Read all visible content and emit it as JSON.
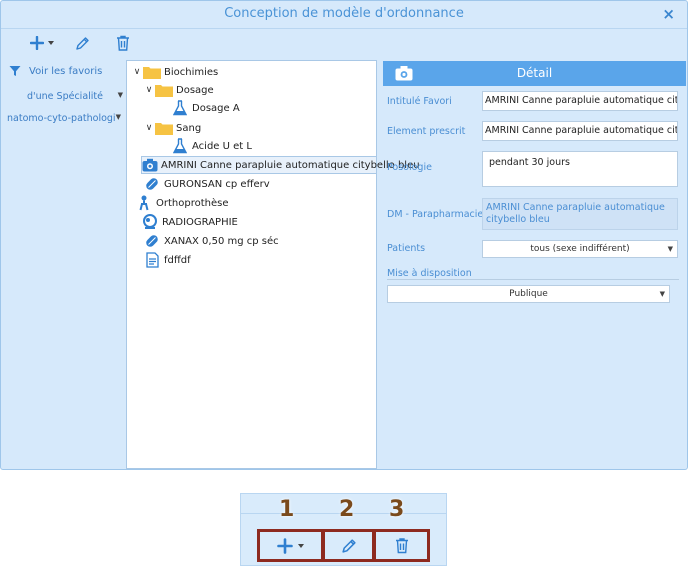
{
  "dialog": {
    "title": "Conception de modèle d'ordonnance",
    "close_glyph": "×"
  },
  "toolbar": {
    "add_icon": "plus-icon",
    "dropdown_icon": "caret-down-icon",
    "edit_icon": "pencil-icon",
    "delete_icon": "trash-icon"
  },
  "filters": {
    "favorites_label": "Voir les favoris",
    "specialty_label": "d'une Spécialité",
    "anatomy_label": "natomo-cyto-pathologi"
  },
  "tree": {
    "nodes": [
      {
        "label": "Biochimies",
        "icon": "folder-icon"
      },
      {
        "label": "Dosage",
        "icon": "folder-icon"
      },
      {
        "label": "Dosage A",
        "icon": "flask-icon"
      },
      {
        "label": "Sang",
        "icon": "folder-icon"
      },
      {
        "label": "Acide U et L",
        "icon": "flask-icon"
      },
      {
        "label": "AMRINI Canne parapluie automatique citybello bleu",
        "icon": "camera-icon"
      },
      {
        "label": "GURONSAN cp efferv",
        "icon": "pill-icon"
      },
      {
        "label": "Orthoprothèse",
        "icon": "prosthesis-icon"
      },
      {
        "label": "RADIOGRAPHIE",
        "icon": "radiography-icon"
      },
      {
        "label": "XANAX 0,50 mg cp séc",
        "icon": "pill-icon"
      },
      {
        "label": "fdffdf",
        "icon": "document-icon"
      }
    ]
  },
  "detail": {
    "header": "Détail",
    "intitule_label": "Intitulé Favori",
    "intitule_value": "AMRINI Canne parapluie automatique citybello bleu",
    "element_label": "Element prescrit",
    "element_value": "AMRINI Canne parapluie automatique citybello bleu",
    "posologie_label": "Posologie",
    "posologie_value": "pendant 30 jours",
    "dm_label": "DM - Parapharmacie",
    "dm_value": "AMRINI Canne parapluie automatique citybello bleu",
    "patients_label": "Patients",
    "patients_value": "tous (sexe indifférent)",
    "mise_label": "Mise à disposition",
    "mise_value": "Publique"
  },
  "callout": {
    "labels": [
      "1",
      "2",
      "3"
    ],
    "accent_color": "#8e2a1f",
    "number_color": "#7a4a1c"
  },
  "colors": {
    "window_bg": "#d6e9fb",
    "accent_blue": "#5aa5ea",
    "label_blue": "#4a8ed3"
  }
}
